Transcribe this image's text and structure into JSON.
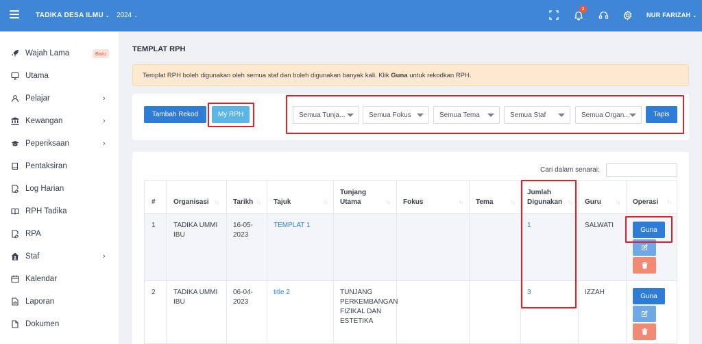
{
  "topbar": {
    "brand": "TADIKA DESA ILMU",
    "year": "2024",
    "notification_count": "2",
    "user": "NUR FARIZAH",
    "color": "#3f86d6"
  },
  "sidebar": {
    "items": [
      {
        "label": "Wajah Lama",
        "icon": "rocket-icon",
        "badge": "Baru"
      },
      {
        "label": "Utama",
        "icon": "monitor-icon"
      },
      {
        "label": "Pelajar",
        "icon": "user-icon",
        "chevron": true
      },
      {
        "label": "Kewangan",
        "icon": "bank-icon",
        "chevron": true
      },
      {
        "label": "Peperiksaan",
        "icon": "graduation-cap-icon",
        "chevron": true
      },
      {
        "label": "Pentaksiran",
        "icon": "book-icon"
      },
      {
        "label": "Log Harian",
        "icon": "document-edit-icon"
      },
      {
        "label": "RPH Tadika",
        "icon": "open-book-icon"
      },
      {
        "label": "RPA",
        "icon": "document-edit-icon"
      },
      {
        "label": "Staf",
        "icon": "house-user-icon",
        "chevron": true
      },
      {
        "label": "Kalendar",
        "icon": "calendar-icon"
      },
      {
        "label": "Laporan",
        "icon": "report-icon"
      },
      {
        "label": "Dokumen",
        "icon": "file-icon"
      }
    ]
  },
  "main": {
    "title": "TEMPLAT RPH",
    "alert": {
      "before": "Templat RPH boleh digunakan oleh semua staf dan boleh digunakan banyak kali. Klik ",
      "bold": "Guna",
      "after": " untuk rekodkan RPH."
    },
    "buttons": {
      "tambah": "Tambah Rekod",
      "myrph": "My RPH",
      "tapis": "Tapis"
    },
    "filters": [
      "Semua Tunja...",
      "Semua Fokus",
      "Semua Tema",
      "Semua Staf",
      "Semua Organ..."
    ],
    "search_label": "Cari dalam senarai:",
    "table": {
      "headers": {
        "no": "#",
        "org": "Organisasi",
        "tarikh": "Tarikh",
        "tajuk": "Tajuk",
        "tunjang_1": "Tunjang",
        "tunjang_2": "Utama",
        "fokus": "Fokus",
        "tema": "Tema",
        "jumlah_1": "Jumlah",
        "jumlah_2": "Digunakan",
        "guru": "Guru",
        "operasi": "Operasi"
      },
      "rows": [
        {
          "no": "1",
          "org_1": "TADIKA UMMI",
          "org_2": "IBU",
          "tarikh_1": "16-05-",
          "tarikh_2": "2023",
          "tajuk": "TEMPLAT 1",
          "tunjang_1": "",
          "tunjang_2": "",
          "tunjang_3": "",
          "tunjang_4": "",
          "jumlah": "1",
          "guru": "SALWATI",
          "guna": "Guna"
        },
        {
          "no": "2",
          "org_1": "TADIKA UMMI",
          "org_2": "IBU",
          "tarikh_1": "06-04-",
          "tarikh_2": "2023",
          "tajuk": "title 2",
          "tunjang_1": "TUNJANG",
          "tunjang_2": "PERKEMBANGAN",
          "tunjang_3": "FIZIKAL DAN",
          "tunjang_4": "ESTETIKA",
          "jumlah": "3",
          "guru": "IZZAH",
          "guna": "Guna"
        }
      ]
    }
  },
  "colors": {
    "primary": "#2e7cd6",
    "info": "#5bb6e6",
    "edit": "#6fa8e6",
    "delete": "#f08a74",
    "highlight": "#e21f26",
    "alert_bg": "#fde9cf"
  }
}
